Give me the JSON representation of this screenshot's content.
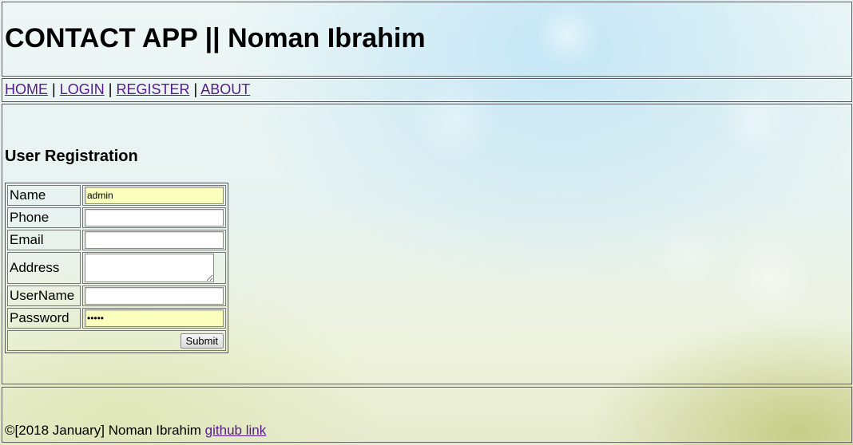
{
  "header": {
    "title": "CONTACT APP || Noman Ibrahim"
  },
  "nav": {
    "items": [
      {
        "label": "HOME"
      },
      {
        "label": "LOGIN"
      },
      {
        "label": "REGISTER"
      },
      {
        "label": "ABOUT"
      }
    ],
    "separator": "|"
  },
  "content": {
    "heading": "User Registration",
    "form": {
      "name_label": "Name",
      "name_value": "admin",
      "phone_label": "Phone",
      "phone_value": "",
      "email_label": "Email",
      "email_value": "",
      "address_label": "Address",
      "address_value": "",
      "username_label": "UserName",
      "username_value": "",
      "password_label": "Password",
      "password_value": "•••••",
      "submit_label": "Submit",
      "autofill_color": "#faffbd"
    }
  },
  "footer": {
    "copyright": "©[2018 January] Noman Ibrahim",
    "link_label": "github link"
  },
  "colors": {
    "link_visited": "#551a8b",
    "frame_border": "#555555"
  }
}
